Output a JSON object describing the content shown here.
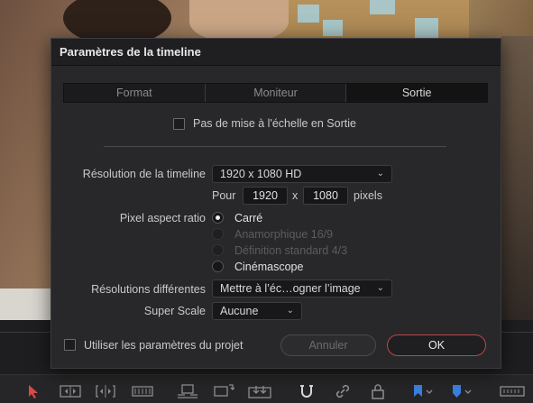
{
  "dialog": {
    "title": "Paramètres de la timeline",
    "tabs": [
      {
        "label": "Format",
        "active": false
      },
      {
        "label": "Moniteur",
        "active": false
      },
      {
        "label": "Sortie",
        "active": true
      }
    ],
    "no_scaling_checkbox": {
      "label": "Pas de mise à l'échelle en Sortie",
      "checked": false
    },
    "timeline_resolution": {
      "label": "Résolution de la timeline",
      "value": "1920 x 1080 HD"
    },
    "custom_size": {
      "for_label": "Pour",
      "width": "1920",
      "x_label": "x",
      "height": "1080",
      "units": "pixels"
    },
    "pixel_aspect": {
      "label": "Pixel aspect ratio",
      "options": [
        {
          "label": "Carré",
          "selected": true,
          "enabled": true
        },
        {
          "label": "Anamorphique 16/9",
          "selected": false,
          "enabled": false
        },
        {
          "label": "Définition standard 4/3",
          "selected": false,
          "enabled": false
        },
        {
          "label": "Cinémascope",
          "selected": false,
          "enabled": true
        }
      ]
    },
    "mismatched_resolution": {
      "label": "Résolutions différentes",
      "value": "Mettre à l’éc…ogner l’image"
    },
    "super_scale": {
      "label": "Super Scale",
      "value": "Aucune"
    },
    "use_project_settings": {
      "label": "Utiliser les paramètres du projet",
      "checked": false
    },
    "buttons": {
      "cancel": "Annuler",
      "ok": "OK"
    }
  },
  "colors": {
    "accent_ok_border": "#b94848",
    "dialog_bg": "#28282a",
    "titlebar_bg": "#1f1f21"
  },
  "toolbar": {
    "icons": [
      "selection-arrow-icon",
      "trim-edit-icon",
      "dynamic-trim-icon",
      "blade-icon",
      "insert-clip-icon",
      "overwrite-clip-icon",
      "replace-clip-icon",
      "snapping-icon",
      "link-icon",
      "lock-icon",
      "flag-icon",
      "marker-icon",
      "zoom-slider-icon"
    ]
  }
}
